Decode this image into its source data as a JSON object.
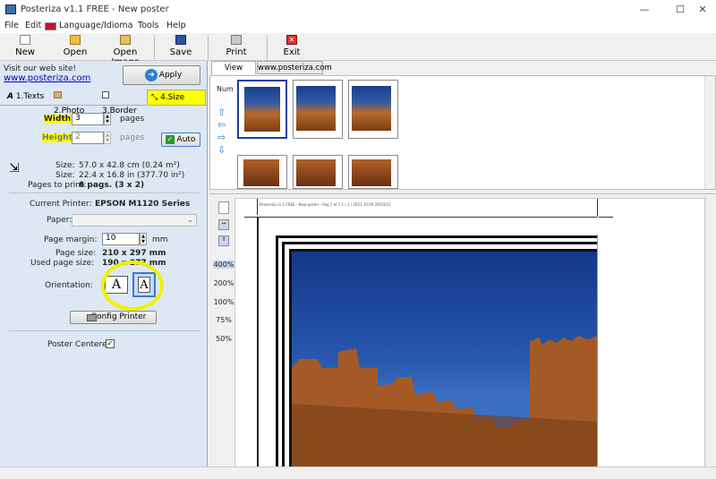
{
  "window": {
    "title": "Posteriza v1.1 FREE - New poster",
    "minimize": "—",
    "maximize": "☐",
    "close": "✕"
  },
  "menu": [
    "File",
    "Edit",
    "Language/Idioma",
    "Tools",
    "Help"
  ],
  "toolbar": {
    "new": "New",
    "open": "Open",
    "open_image": "Open Image",
    "save": "Save",
    "print": "Print",
    "exit": "Exit"
  },
  "left": {
    "visit": "Visit our web site!",
    "url": "www.posteriza.com",
    "apply": "Apply",
    "tabs": [
      "1.Texts",
      "2.Photo",
      "3.Border",
      "4.Size"
    ],
    "width_label": "Width:",
    "width_value": "3",
    "height_label": "Height:",
    "height_value": "2",
    "pages_unit": "pages",
    "auto": "Auto",
    "size_label": "Size:",
    "size_cm": "57.0 x 42.8 cm (0.24 m²)",
    "size_in": "22.4 x 16.8 in (377.70 in²)",
    "pages_to_print_label": "Pages to print:",
    "pages_to_print": "6 pags. (3 x 2)",
    "current_printer_label": "Current Printer:",
    "current_printer": "EPSON M1120 Series",
    "paper_label": "Paper:",
    "page_margin_label": "Page margin:",
    "page_margin": "10",
    "mm": "mm",
    "page_size_label": "Page size:",
    "page_size": "210 x 297 mm",
    "used_page_size_label": "Used page size:",
    "used_page_size": "190 x 277 mm",
    "orientation_label": "Orientation:",
    "config_printer": "Config Printer",
    "poster_centered_label": "Poster Centered:",
    "poster_centered": "✓"
  },
  "view_tabs": [
    "View Poster",
    "www.posteriza.com"
  ],
  "num_label": "Num",
  "zoom_levels": [
    "400%",
    "200%",
    "100%",
    "75%",
    "50%"
  ],
  "preview_header": "Posteriza v1.1 FREE - New poster - Pag 1 of 1 1 / 1 / 2021 10:09 29/03/21",
  "colors": {
    "highlight": "#ffff00",
    "panel": "#dde8f4",
    "sky": "#2f5aa8",
    "wall": "#b86a2c"
  }
}
